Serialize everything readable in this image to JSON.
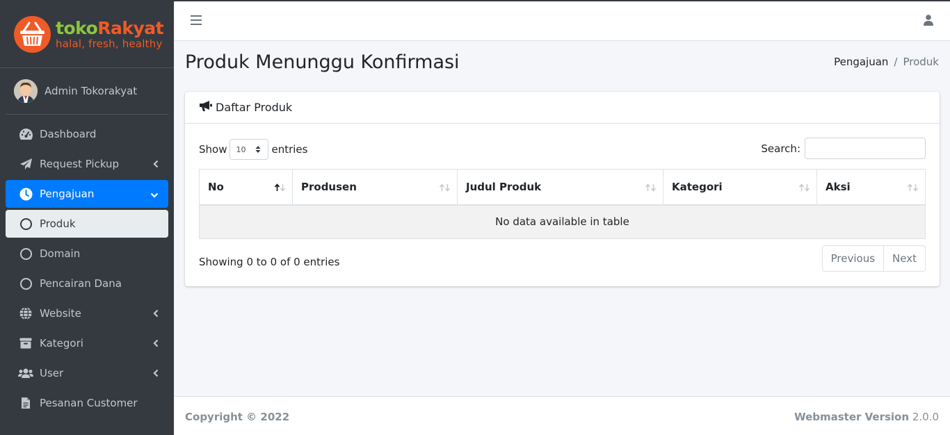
{
  "brand": {
    "name_part1": "toko",
    "name_part2": "Rakyat",
    "tagline": "halal, fresh, healthy"
  },
  "user": {
    "name": "Admin Tokorakyat"
  },
  "sidebar": {
    "items": [
      {
        "label": "Dashboard",
        "icon": "tachometer-icon"
      },
      {
        "label": "Request Pickup",
        "icon": "paper-plane-icon"
      },
      {
        "label": "Pengajuan",
        "icon": "clock-icon"
      },
      {
        "label": "Produk",
        "icon": "circle-icon"
      },
      {
        "label": "Domain",
        "icon": "circle-icon"
      },
      {
        "label": "Pencairan Dana",
        "icon": "circle-icon"
      },
      {
        "label": "Website",
        "icon": "globe-icon"
      },
      {
        "label": "Kategori",
        "icon": "archive-icon"
      },
      {
        "label": "User",
        "icon": "users-icon"
      },
      {
        "label": "Pesanan Customer",
        "icon": "file-icon"
      }
    ]
  },
  "page": {
    "title": "Produk Menunggu Konfirmasi"
  },
  "breadcrumb": {
    "parent": "Pengajuan",
    "separator": "/",
    "current": "Produk"
  },
  "card": {
    "title": "Daftar Produk"
  },
  "table_controls": {
    "show_label": "Show",
    "entries_value": "10",
    "entries_label": "entries",
    "search_label": "Search:",
    "search_value": ""
  },
  "table": {
    "columns": [
      "No",
      "Produsen",
      "Judul Produk",
      "Kategori",
      "Aksi"
    ],
    "empty_message": "No data available in table",
    "info": "Showing 0 to 0 of 0 entries"
  },
  "pagination": {
    "previous": "Previous",
    "next": "Next"
  },
  "footer": {
    "copyright": "Copyright © 2022",
    "version_label": "Webmaster Version",
    "version_number": "2.0.0"
  },
  "colors": {
    "sidebar_bg": "#343a40",
    "accent": "#007bff",
    "brand_green": "#8cc63f",
    "brand_orange": "#f05a28"
  }
}
